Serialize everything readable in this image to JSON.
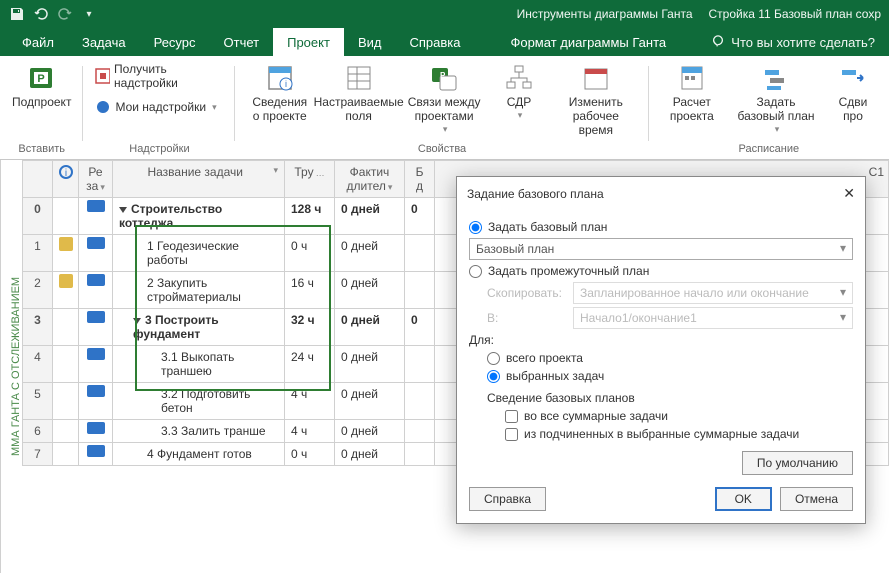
{
  "titlebar": {
    "context_tool": "Инструменты диаграммы Ганта",
    "doc_title": "Стройка 11 Базовый план сохр"
  },
  "tabs": {
    "file": "Файл",
    "task": "Задача",
    "resource": "Ресурс",
    "report": "Отчет",
    "project": "Проект",
    "view": "Вид",
    "help": "Справка",
    "gantt_format": "Формат диаграммы Ганта",
    "tell_me": "Что вы хотите сделать?"
  },
  "ribbon": {
    "insert_group": "Вставить",
    "addins_group": "Надстройки",
    "props_group": "Свойства",
    "schedule_group": "Расписание",
    "subproject": "Подпроект",
    "get_addins": "Получить надстройки",
    "my_addins": "Мои надстройки",
    "project_info": "Сведения о проекте",
    "custom_fields": "Настраиваемые поля",
    "links": "Связи между проектами",
    "wbs": "СДР",
    "change_time": "Изменить рабочее время",
    "calc_project": "Расчет проекта",
    "set_baseline": "Задать базовый план",
    "move": "Сдви\nпро"
  },
  "side_label": "ММА ГАНТА С ОТСЛЕЖИВАНИЕМ",
  "columns": {
    "info": "",
    "re": "Ре\nза",
    "name": "Название задачи",
    "work": "Тру",
    "actual_dur": "Фактич\nдлител",
    "b": "Б\nд"
  },
  "rows": [
    {
      "n": "0",
      "ind": false,
      "name": "Строительство коттеджа",
      "work": "128 ч",
      "dur": "0 дней",
      "b": "0",
      "bold": true,
      "tri": true,
      "indent": 0
    },
    {
      "n": "1",
      "ind": true,
      "name": "1 Геодезические работы",
      "work": "0 ч",
      "dur": "0 дней",
      "b": "",
      "bold": false,
      "tri": false,
      "indent": 2
    },
    {
      "n": "2",
      "ind": true,
      "name": "2 Закупить стройматериалы",
      "work": "16 ч",
      "dur": "0 дней",
      "b": "",
      "bold": false,
      "tri": false,
      "indent": 2
    },
    {
      "n": "3",
      "ind": false,
      "name": "3 Построить фундамент",
      "work": "32 ч",
      "dur": "0 дней",
      "b": "0",
      "bold": true,
      "tri": true,
      "indent": 1
    },
    {
      "n": "4",
      "ind": false,
      "name": "3.1 Выкопать траншею",
      "work": "24 ч",
      "dur": "0 дней",
      "b": "",
      "bold": false,
      "tri": false,
      "indent": 3
    },
    {
      "n": "5",
      "ind": false,
      "name": "3.2 Подготовить бетон",
      "work": "4 ч",
      "dur": "0 дней",
      "b": "",
      "bold": false,
      "tri": false,
      "indent": 3
    },
    {
      "n": "6",
      "ind": false,
      "name": "3.3 Залить транше",
      "work": "4 ч",
      "dur": "0 дней",
      "b": "",
      "bold": false,
      "tri": false,
      "indent": 3
    },
    {
      "n": "7",
      "ind": false,
      "name": "4 Фундамент готов",
      "work": "0 ч",
      "dur": "0 дней",
      "b": "",
      "bold": false,
      "tri": false,
      "indent": 2
    }
  ],
  "dialog": {
    "title": "Задание базового плана",
    "opt_baseline": "Задать базовый план",
    "baseline_value": "Базовый план",
    "opt_interim": "Задать промежуточный план",
    "copy_label": "Скопировать:",
    "copy_value": "Запланированное начало или окончание",
    "into_label": "В:",
    "into_value": "Начало1/окончание1",
    "for_label": "Для:",
    "for_all": "всего проекта",
    "for_selected": "выбранных задач",
    "rollup_title": "Сведение базовых планов",
    "rollup_all": "во все суммарные задачи",
    "rollup_from": "из подчиненных в выбранные суммарные задачи",
    "btn_default": "По умолчанию",
    "btn_help": "Справка",
    "btn_ok": "OK",
    "btn_cancel": "Отмена"
  },
  "c1_label": "С1"
}
